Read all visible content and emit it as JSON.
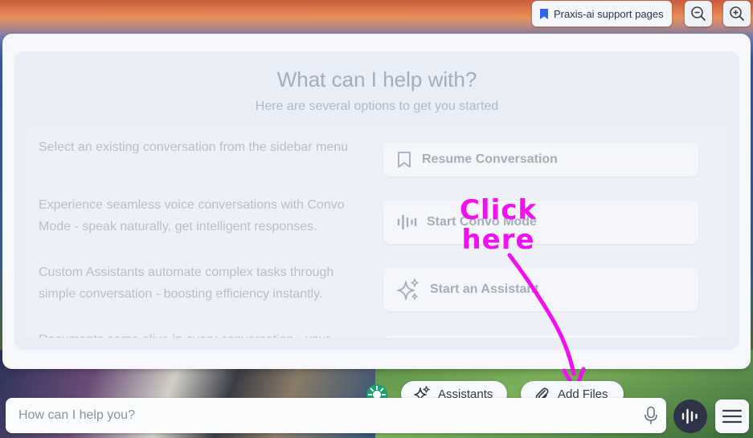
{
  "header": {
    "support_label": "Praxis-ai support pages",
    "zoom_out_icon": "zoom-out-icon",
    "zoom_in_icon": "zoom-in-icon"
  },
  "welcome": {
    "title": "What can I help with?",
    "subtitle": "Here are several options to get you started"
  },
  "options": [
    {
      "description": "Select an existing conversation from the sidebar menu",
      "button_label": "Resume Conversation",
      "icon": "bookmark-icon"
    },
    {
      "description": "Experience seamless voice conversations with Convo Mode - speak naturally, get intelligent responses.",
      "button_label": "Start Convo Mode",
      "icon": "audio-wave-icon"
    },
    {
      "description": "Custom Assistants automate complex tasks through simple conversation - boosting efficiency instantly.",
      "button_label": "Start an Assistant",
      "icon": "sparkles-icon"
    },
    {
      "description": "Documents come alive in every conversation - your",
      "button_label": "",
      "icon": ""
    }
  ],
  "annotation": {
    "text_line1": "Click",
    "text_line2": "here",
    "color": "#f010f0"
  },
  "toolbar": {
    "assistants_label": "Assistants",
    "add_files_label": "Add Files"
  },
  "composer": {
    "placeholder": "How can I help you?"
  },
  "colors": {
    "panel": "#f5f7fb",
    "voice_button": "#2e3347",
    "logo": "#1aa06a"
  }
}
